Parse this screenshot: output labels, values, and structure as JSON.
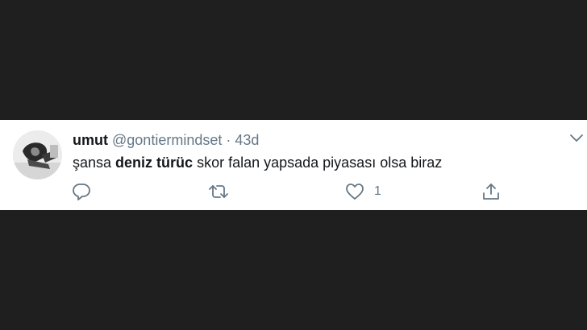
{
  "tweet": {
    "author_name": "umut",
    "handle": "@gontiermindset",
    "separator": "·",
    "time": "43d",
    "text_before": "şansa ",
    "mention": "deniz türüc",
    "text_after": " skor falan yapsada piyasası olsa biraz",
    "like_count": "1"
  },
  "icons": {
    "reply": "reply-icon",
    "retweet": "retweet-icon",
    "like": "heart-icon",
    "share": "share-icon",
    "menu": "chevron-down-icon"
  },
  "colors": {
    "background": "#1f1f1f",
    "card": "#ffffff",
    "text": "#14171a",
    "secondary": "#657786"
  }
}
